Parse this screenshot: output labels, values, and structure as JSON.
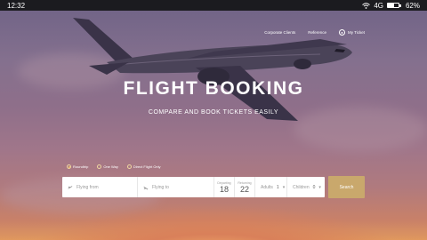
{
  "status": {
    "time": "12:32",
    "network": "4G",
    "battery": "62%"
  },
  "nav": {
    "corporate": "Corporate Clients",
    "reference": "Reference",
    "ticket": "My Ticket"
  },
  "hero": {
    "title": "FLIGHT BOOKING",
    "subtitle": "COMPARE AND BOOK TICKETS EASILY"
  },
  "trip_types": [
    {
      "label": "Roundtrip",
      "selected": true
    },
    {
      "label": "One Way",
      "selected": false
    },
    {
      "label": "Direct Flight Only",
      "selected": false
    }
  ],
  "search": {
    "from_placeholder": "Flying from",
    "to_placeholder": "Flying to",
    "departing_label": "Departing",
    "departing_day": "18",
    "returning_label": "Returning",
    "returning_day": "22",
    "adults_label": "Adults",
    "adults_value": "1",
    "children_label": "Children",
    "children_value": "0",
    "button": "Search"
  },
  "colors": {
    "accent": "#c9a86c",
    "status_bar": "#1b1b1f"
  }
}
